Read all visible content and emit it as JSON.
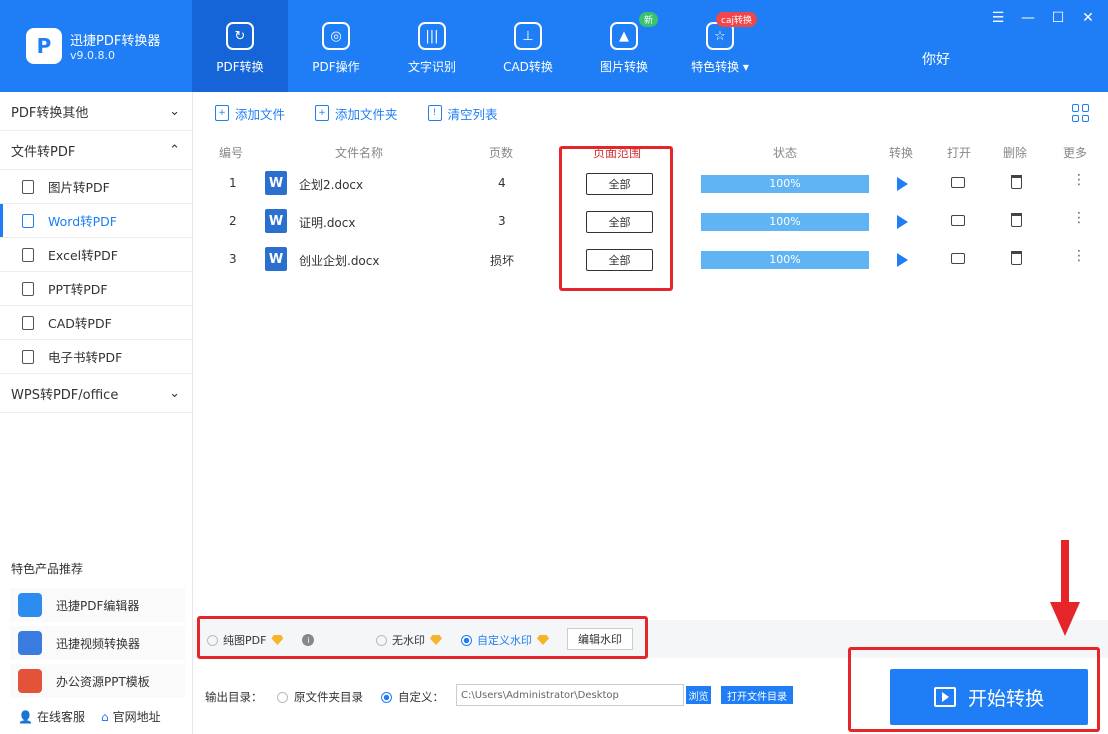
{
  "app": {
    "name": "迅捷PDF转换器",
    "version": "v9.0.8.0",
    "greeting": "你好"
  },
  "window_controls": [
    "☰",
    "—",
    "☐",
    "✕"
  ],
  "nav": [
    {
      "label": "PDF转换",
      "icon": "pdf-convert-icon",
      "glyph": "↻"
    },
    {
      "label": "PDF操作",
      "icon": "pdf-operate-icon",
      "glyph": "◎"
    },
    {
      "label": "文字识别",
      "icon": "ocr-icon",
      "glyph": "|||"
    },
    {
      "label": "CAD转换",
      "icon": "cad-icon",
      "glyph": "⊥"
    },
    {
      "label": "图片转换",
      "icon": "image-icon",
      "glyph": "▲"
    },
    {
      "label": "特色转换 ▾",
      "icon": "feature-icon",
      "glyph": "☆"
    }
  ],
  "nav_badges": {
    "image": "新",
    "feature": "caj转换"
  },
  "sidebar": {
    "groups": [
      "PDF转换其他",
      "文件转PDF",
      "WPS转PDF/office"
    ],
    "items": [
      "图片转PDF",
      "Word转PDF",
      "Excel转PDF",
      "PPT转PDF",
      "CAD转PDF",
      "电子书转PDF"
    ],
    "recommend_title": "特色产品推荐",
    "recommend": [
      "迅捷PDF编辑器",
      "迅捷视频转换器",
      "办公资源PPT模板"
    ],
    "footer": [
      "在线客服",
      "官网地址"
    ]
  },
  "toolbar": {
    "add_file": "添加文件",
    "add_folder": "添加文件夹",
    "clear_list": "清空列表"
  },
  "table": {
    "headers": {
      "num": "编号",
      "name": "文件名称",
      "pages": "页数",
      "range": "页面范围",
      "status": "状态",
      "convert": "转换",
      "open": "打开",
      "delete": "删除",
      "more": "更多"
    },
    "rows": [
      {
        "num": "1",
        "name": "企划2.docx",
        "pages": "4",
        "range": "全部",
        "progress": "100%",
        "progress_value": 100
      },
      {
        "num": "2",
        "name": "证明.docx",
        "pages": "3",
        "range": "全部",
        "progress": "100%",
        "progress_value": 100
      },
      {
        "num": "3",
        "name": "创业企划.docx",
        "pages": "损坏",
        "range": "全部",
        "progress": "100%",
        "progress_value": 100
      }
    ],
    "more_glyph": "⋮"
  },
  "options": {
    "pure_pdf": "纯图PDF",
    "no_watermark": "无水印",
    "custom_watermark": "自定义水印",
    "edit_watermark": "编辑水印"
  },
  "output": {
    "label": "输出目录：",
    "original_dir": "原文件夹目录",
    "custom": "自定义：",
    "path": "C:\\Users\\Administrator\\Desktop",
    "browse": "浏览",
    "open_folder": "打开文件目录"
  },
  "start_button": "开始转换",
  "colors": {
    "brand": "#1f7ef5",
    "highlight": "#e5252a"
  }
}
